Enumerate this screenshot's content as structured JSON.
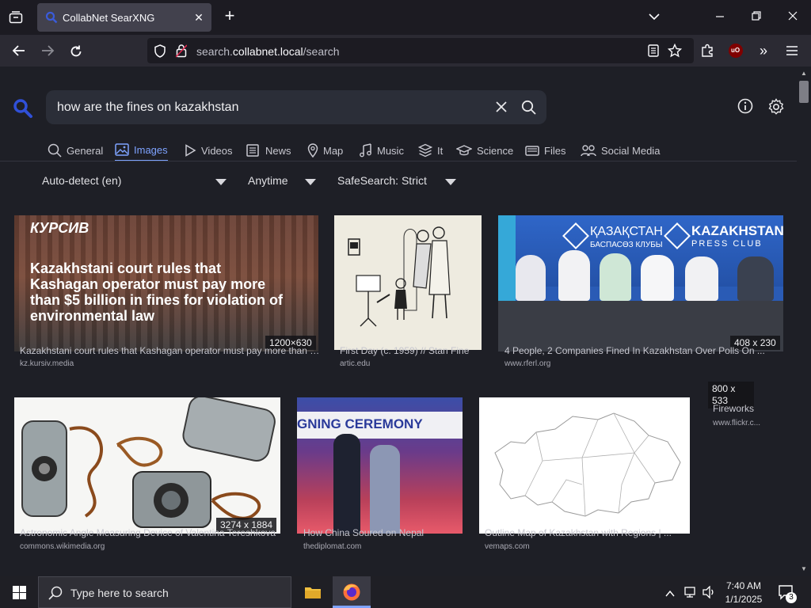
{
  "browser": {
    "tab_title": "CollabNet SearXNG",
    "url_domain": "search.",
    "url_host": "collabnet.local",
    "url_path": "/search"
  },
  "search": {
    "query": "how are the fines on kazakhstan"
  },
  "categories": [
    {
      "label": "General",
      "icon": "search-icon"
    },
    {
      "label": "Images",
      "icon": "image-icon",
      "active": true
    },
    {
      "label": "Videos",
      "icon": "play-icon"
    },
    {
      "label": "News",
      "icon": "newspaper-icon"
    },
    {
      "label": "Map",
      "icon": "map-pin-icon"
    },
    {
      "label": "Music",
      "icon": "music-note-icon"
    },
    {
      "label": "It",
      "icon": "layers-icon"
    },
    {
      "label": "Science",
      "icon": "graduation-cap-icon"
    },
    {
      "label": "Files",
      "icon": "folder-icon"
    },
    {
      "label": "Social Media",
      "icon": "people-icon"
    }
  ],
  "filters": {
    "language": "Auto-detect (en)",
    "time": "Anytime",
    "safesearch": "SafeSearch: Strict"
  },
  "results": [
    {
      "title": "Kazakhstani court rules that Kashagan operator must pay more than $5 billion in fines",
      "source": "kz.kursiv.media",
      "size": "1200×630",
      "thumb_brand": "КУРСИВ",
      "thumb_headline": "Kazakhstani court rules that Kashagan operator must pay more than $5 billion in fines for violation of environmental law"
    },
    {
      "title": "First Day (c. 1959) // Stan Fine",
      "source": "artic.edu",
      "size": ""
    },
    {
      "title": "4 People, 2 Companies Fined In Kazakhstan Over Polls On ...",
      "source": "www.rferl.org",
      "size": "408 x 230",
      "thumb_banner_kz": "ҚАЗАҚСТАН",
      "thumb_banner_kz2": "БАСПАСӨЗ КЛУБЫ",
      "thumb_banner_en": "KAZAKHSTAN",
      "thumb_banner_en2": "PRESS CLUB"
    },
    {
      "title": "Fireworks",
      "source": "www.flickr.c...",
      "size": "800 x 533"
    },
    {
      "title": "Astronomic Angle Measuring Device of Valentina Tereshkova",
      "source": "commons.wikimedia.org",
      "size": "3274 x 1884"
    },
    {
      "title": "How China Soured on Nepal",
      "source": "thediplomat.com",
      "size": "",
      "thumb_banner": "GNING CEREMONY"
    },
    {
      "title": "Outline Map of Kazakhstan with Regions | ...",
      "source": "vemaps.com",
      "size": ""
    }
  ],
  "taskbar": {
    "search_placeholder": "Type here to search",
    "time": "7:40 AM",
    "date": "1/1/2025",
    "notifications": "3"
  }
}
